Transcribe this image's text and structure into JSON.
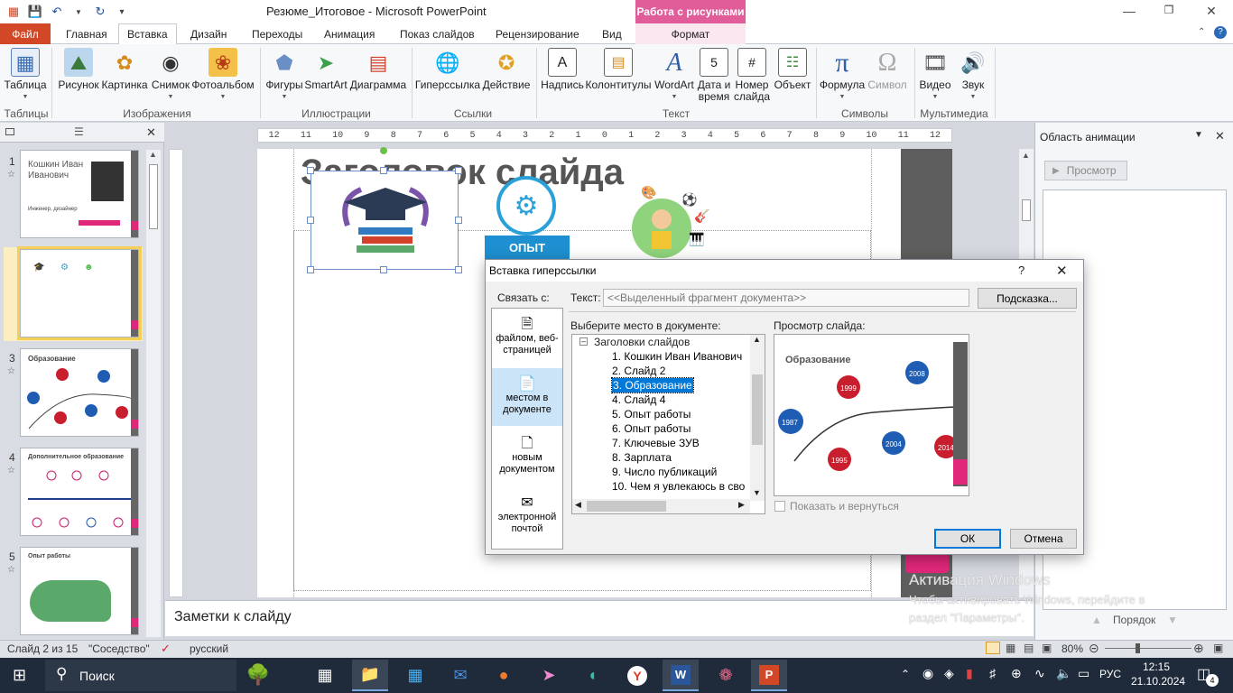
{
  "window": {
    "title": "Резюме_Итоговое - Microsoft PowerPoint",
    "context_tab_title": "Работа с рисунками"
  },
  "tabs": [
    {
      "label": "Файл"
    },
    {
      "label": "Главная"
    },
    {
      "label": "Вставка"
    },
    {
      "label": "Дизайн"
    },
    {
      "label": "Переходы"
    },
    {
      "label": "Анимация"
    },
    {
      "label": "Показ слайдов"
    },
    {
      "label": "Рецензирование"
    },
    {
      "label": "Вид"
    },
    {
      "label": "Формат"
    }
  ],
  "ribbon": {
    "buttons": {
      "table": "Таблица",
      "picture": "Рисунок",
      "clipart": "Картинка",
      "screenshot": "Снимок",
      "album": "Фотоальбом",
      "shapes": "Фигуры",
      "smartart": "SmartArt",
      "chart": "Диаграмма",
      "hyperlink": "Гиперссылка",
      "action": "Действие",
      "textbox": "Надпись",
      "headerfooter": "Колонтитулы",
      "wordart": "WordArt",
      "datetime": "Дата и время",
      "slidenumber": "Номер слайда",
      "object": "Объект",
      "equation": "Формула",
      "symbol": "Символ",
      "video": "Видео",
      "audio": "Звук"
    },
    "groups": {
      "tables": "Таблицы",
      "images": "Изображения",
      "illustrations": "Иллюстрации",
      "links": "Ссылки",
      "text": "Текст",
      "symbols": "Символы",
      "media": "Мультимедиа"
    }
  },
  "slides_panel": {
    "thumbs": [
      {
        "num": "1",
        "name": "Кошкин Иван Иванович",
        "sub": "Инженер, дизайнер"
      },
      {
        "num": "2",
        "name": ""
      },
      {
        "num": "3",
        "name": "Образование"
      },
      {
        "num": "4",
        "name": "Дополнительное образование"
      },
      {
        "num": "5",
        "name": "Опыт работы"
      }
    ]
  },
  "slide": {
    "title_placeholder": "Заголовок слайда",
    "badge": "ОПЫТ"
  },
  "ruler": {
    "marks": [
      "12",
      "11",
      "10",
      "9",
      "8",
      "7",
      "6",
      "5",
      "4",
      "3",
      "2",
      "1",
      "0",
      "1",
      "2",
      "3",
      "4",
      "5",
      "6",
      "7",
      "8",
      "9",
      "10",
      "11",
      "12"
    ]
  },
  "notes": {
    "placeholder": "Заметки к слайду"
  },
  "anim_pane": {
    "title": "Область анимации",
    "preview_btn": "Просмотр",
    "order_label": "Порядок"
  },
  "watermark": {
    "line1": "Активация Windows",
    "line2": "Чтобы активировать Windows, перейдите в",
    "line3": "раздел \"Параметры\"."
  },
  "status": {
    "slide": "Слайд 2 из 15",
    "theme": "\"Соседство\"",
    "lang": "русский",
    "zoom": "80%"
  },
  "taskbar": {
    "search": "Поиск",
    "lang": "РУС",
    "time": "12:15",
    "date": "21.10.2024",
    "notif": "4"
  },
  "dialog": {
    "title": "Вставка гиперссылки",
    "help": "?",
    "link_to": "Связать с:",
    "text_label": "Текст:",
    "text_value": "<<Выделенный фрагмент документа>>",
    "tooltip_btn": "Подсказка...",
    "options": [
      {
        "label": "файлом, веб-страницей"
      },
      {
        "label": "местом в документе"
      },
      {
        "label": "новым документом"
      },
      {
        "label": "электронной почтой"
      }
    ],
    "place_label": "Выберите место в документе:",
    "preview_label": "Просмотр слайда:",
    "tree_root": "Заголовки слайдов",
    "tree_items": [
      "1. Кошкин  Иван  Иванович",
      "2. Слайд 2",
      "3. Образование",
      "4. Слайд 4",
      "5. Опыт работы",
      "6. Опыт работы",
      "7. Ключевые ЗУВ",
      "8. Зарплата",
      "9. Число публикаций",
      "10. Чем я увлекаюсь в сво"
    ],
    "preview_title": "Образование",
    "preview_years": [
      "1987",
      "1999",
      "1995",
      "2004",
      "2008",
      "2014"
    ],
    "show_return": "Показать и вернуться",
    "ok": "ОК",
    "cancel": "Отмена"
  },
  "colors": {
    "accent": "#e0277a",
    "file_tab": "#d24726",
    "context": "#e05d9a",
    "selection": "#0078d7"
  }
}
